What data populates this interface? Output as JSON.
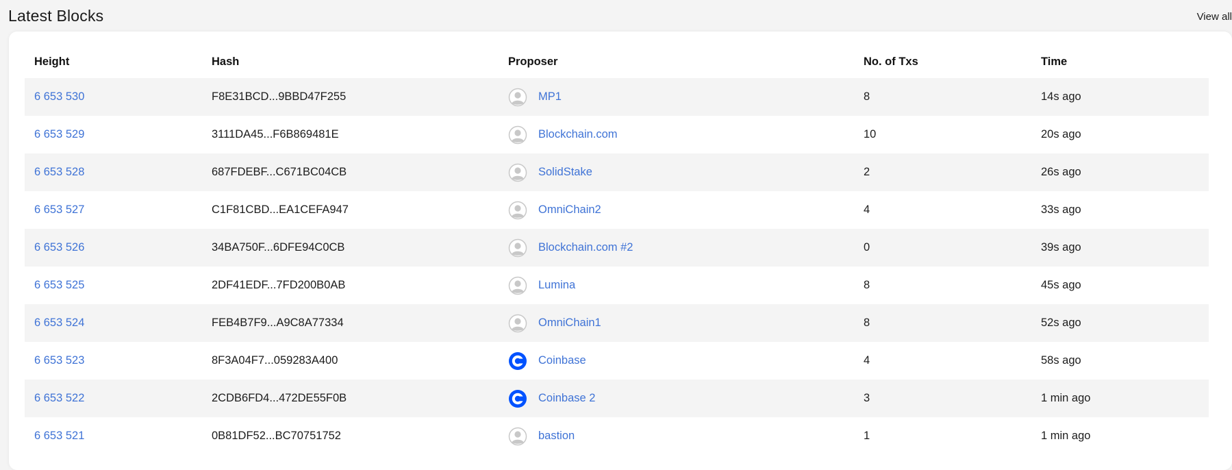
{
  "section": {
    "title": "Latest Blocks",
    "view_all": "View all"
  },
  "table": {
    "headers": {
      "height": "Height",
      "hash": "Hash",
      "proposer": "Proposer",
      "txs": "No. of Txs",
      "time": "Time"
    },
    "rows": [
      {
        "height": "6 653 530",
        "hash": "F8E31BCD...9BBD47F255",
        "proposer": "MP1",
        "avatar": "default-avatar-icon",
        "txs": "8",
        "time": "14s ago"
      },
      {
        "height": "6 653 529",
        "hash": "3111DA45...F6B869481E",
        "proposer": "Blockchain.com",
        "avatar": "default-avatar-icon",
        "txs": "10",
        "time": "20s ago"
      },
      {
        "height": "6 653 528",
        "hash": "687FDEBF...C671BC04CB",
        "proposer": "SolidStake",
        "avatar": "default-avatar-icon",
        "txs": "2",
        "time": "26s ago"
      },
      {
        "height": "6 653 527",
        "hash": "C1F81CBD...EA1CEFA947",
        "proposer": "OmniChain2",
        "avatar": "default-avatar-icon",
        "txs": "4",
        "time": "33s ago"
      },
      {
        "height": "6 653 526",
        "hash": "34BA750F...6DFE94C0CB",
        "proposer": "Blockchain.com #2",
        "avatar": "default-avatar-icon",
        "txs": "0",
        "time": "39s ago"
      },
      {
        "height": "6 653 525",
        "hash": "2DF41EDF...7FD200B0AB",
        "proposer": "Lumina",
        "avatar": "default-avatar-icon",
        "txs": "8",
        "time": "45s ago"
      },
      {
        "height": "6 653 524",
        "hash": "FEB4B7F9...A9C8A77334",
        "proposer": "OmniChain1",
        "avatar": "default-avatar-icon",
        "txs": "8",
        "time": "52s ago"
      },
      {
        "height": "6 653 523",
        "hash": "8F3A04F7...059283A400",
        "proposer": "Coinbase",
        "avatar": "coinbase-logo-icon",
        "txs": "4",
        "time": "58s ago"
      },
      {
        "height": "6 653 522",
        "hash": "2CDB6FD4...472DE55F0B",
        "proposer": "Coinbase 2",
        "avatar": "coinbase-logo-icon",
        "txs": "3",
        "time": "1 min ago"
      },
      {
        "height": "6 653 521",
        "hash": "0B81DF52...BC70751752",
        "proposer": "bastion",
        "avatar": "default-avatar-icon",
        "txs": "1",
        "time": "1 min ago"
      }
    ]
  },
  "colors": {
    "link": "#3f73d6",
    "row_stripe": "#f4f4f4",
    "coinbase_blue": "#0052ff",
    "avatar_gray": "#c8c8c8"
  }
}
